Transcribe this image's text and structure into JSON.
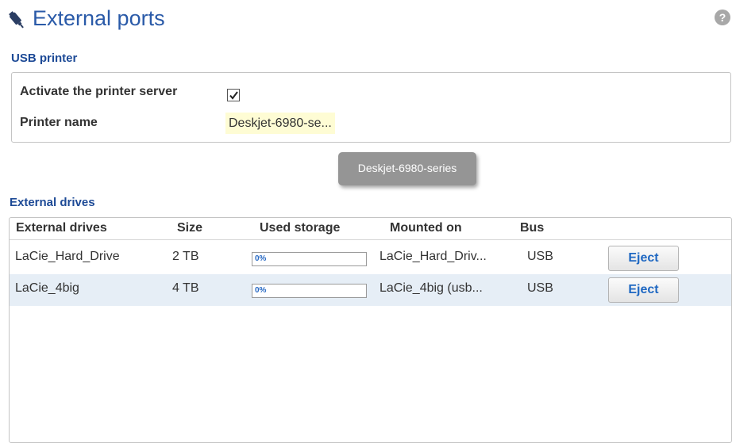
{
  "header": {
    "title": "External ports",
    "help_icon": "question-mark-icon",
    "help_label": "?",
    "title_icon": "usb-plug-icon"
  },
  "usb_printer": {
    "heading": "USB printer",
    "activate_label": "Activate the printer server",
    "activate_checked": true,
    "name_label": "Printer name",
    "name_value": "Deskjet-6980-se...",
    "tooltip": "Deskjet-6980-series"
  },
  "external_drives": {
    "heading": "External drives",
    "columns": [
      "External drives",
      "Size",
      "Used storage",
      "Mounted on",
      "Bus"
    ],
    "rows": [
      {
        "name": "LaCie_Hard_Drive",
        "size": "2 TB",
        "used_label": "0%",
        "used_fraction": 0.0,
        "mounted_on": "LaCie_Hard_Driv...",
        "bus": "USB",
        "action": "Eject"
      },
      {
        "name": "LaCie_4big",
        "size": "4 TB",
        "used_label": "0%",
        "used_fraction": 0.0,
        "mounted_on": "LaCie_4big (usb...",
        "bus": "USB",
        "action": "Eject"
      }
    ]
  },
  "colors": {
    "title": "#2a5aa8",
    "heading": "#1d4a96",
    "highlight": "#fefcd4",
    "selected_row": "#e6eef6",
    "button_text": "#1f68c2"
  }
}
